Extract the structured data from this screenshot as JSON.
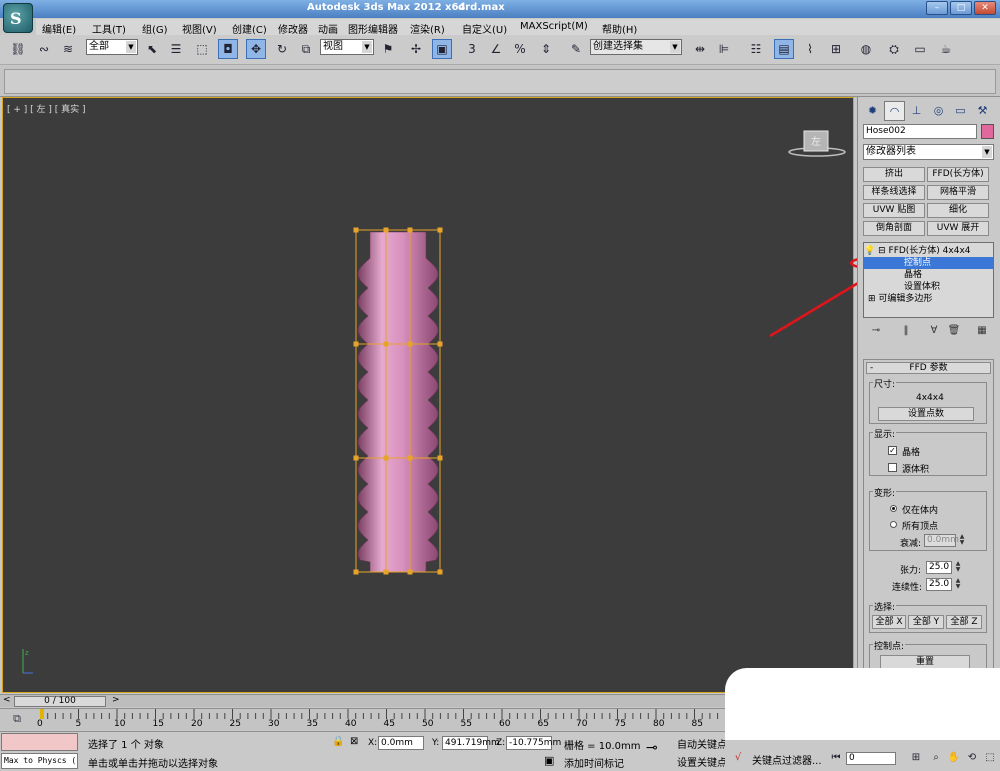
{
  "window": {
    "title": "Autodesk 3ds Max  2012 x64",
    "document": "drd.max"
  },
  "menu": [
    "编辑(E)",
    "工具(T)",
    "组(G)",
    "视图(V)",
    "创建(C)",
    "修改器",
    "动画",
    "图形编辑器",
    "渲染(R)",
    "自定义(U)",
    "MAXScript(M)",
    "帮助(H)"
  ],
  "toolbar": {
    "selection_filter": "全部",
    "reference_coord": "视图",
    "named_selection": "创建选择集",
    "percent_snap": "%",
    "snap_3": "3",
    "icons": [
      "link-icon",
      "unlink-icon",
      "bind-spacewarp-icon",
      "select-icon",
      "select-by-name-icon",
      "rect-region-icon",
      "window-crossing-icon",
      "move-icon",
      "rotate-icon",
      "scale-icon",
      "pivot-icon",
      "manipulate-icon",
      "keyboard-shortcut-icon",
      "snap-icon",
      "angle-snap-icon",
      "percent-snap-icon",
      "spinner-snap-icon",
      "edit-named-sets-icon",
      "mirror-icon",
      "align-icon",
      "layer-icon",
      "ribbon-toggle-icon",
      "curve-editor-icon",
      "schematic-icon",
      "material-editor-icon",
      "render-setup-icon",
      "render-frame-icon",
      "render-icon"
    ]
  },
  "viewport": {
    "label": "[ + ] [ 左 ] [ 真实 ]",
    "viewcube_label": "左",
    "object_color": "#d98ab6",
    "lattice_color": "#e8a32a"
  },
  "command_panel": {
    "object_name": "Hose002",
    "object_color": "#e0689c",
    "modifier_list": "修改器列表",
    "modifier_buttons": [
      "挤出",
      "FFD(长方体)",
      "样条线选择",
      "网格平滑",
      "UVW 贴图",
      "细化",
      "倒角剖面",
      "UVW 展开"
    ],
    "stack": {
      "modifier": "FFD(长方体) 4x4x4",
      "subitems": [
        "控制点",
        "晶格",
        "设置体积"
      ],
      "selected": "控制点",
      "base": "可编辑多边形"
    },
    "rollout": {
      "title": "FFD 参数",
      "dimensions_label": "尺寸:",
      "dimensions_value": "4x4x4",
      "set_points_button": "设置点数",
      "display_label": "显示:",
      "lattice_check": "晶格",
      "lattice_checked": true,
      "source_volume_check": "源体积",
      "source_volume_checked": false,
      "deform_label": "变形:",
      "only_in_volume": "仅在体内",
      "all_vertices": "所有顶点",
      "falloff_label": "衰减:",
      "falloff_value": "0.0mm",
      "tension_label": "张力:",
      "tension_value": "25.0",
      "continuity_label": "连续性:",
      "continuity_value": "25.0",
      "select_label": "选择:",
      "select_buttons": [
        "全部 X",
        "全部 Y",
        "全部 Z"
      ],
      "control_points_label": "控制点:",
      "reset_button": "重置"
    }
  },
  "timeline": {
    "frame": "0 / 100",
    "ticks": [
      "0",
      "5",
      "10",
      "15",
      "20",
      "25",
      "30",
      "35",
      "40",
      "45",
      "50",
      "55",
      "60",
      "65",
      "70",
      "75",
      "80",
      "85"
    ]
  },
  "status": {
    "listener_text": "Max to Physcs (",
    "selected_text": "选择了 1 个 对象",
    "prompt_text": "单击或单击并拖动以选择对象",
    "x_label": "X:",
    "x_value": "0.0mm",
    "y_label": "Y:",
    "y_value": "491.719mm",
    "z_label": "Z:",
    "z_value": "-10.775mm",
    "grid_text": "栅格 = 10.0mm",
    "add_time_tag": "添加时间标记",
    "auto_key": "自动关键点",
    "set_key": "设置关键点",
    "key_filters": "关键点过滤器...",
    "frame_field": "0"
  }
}
